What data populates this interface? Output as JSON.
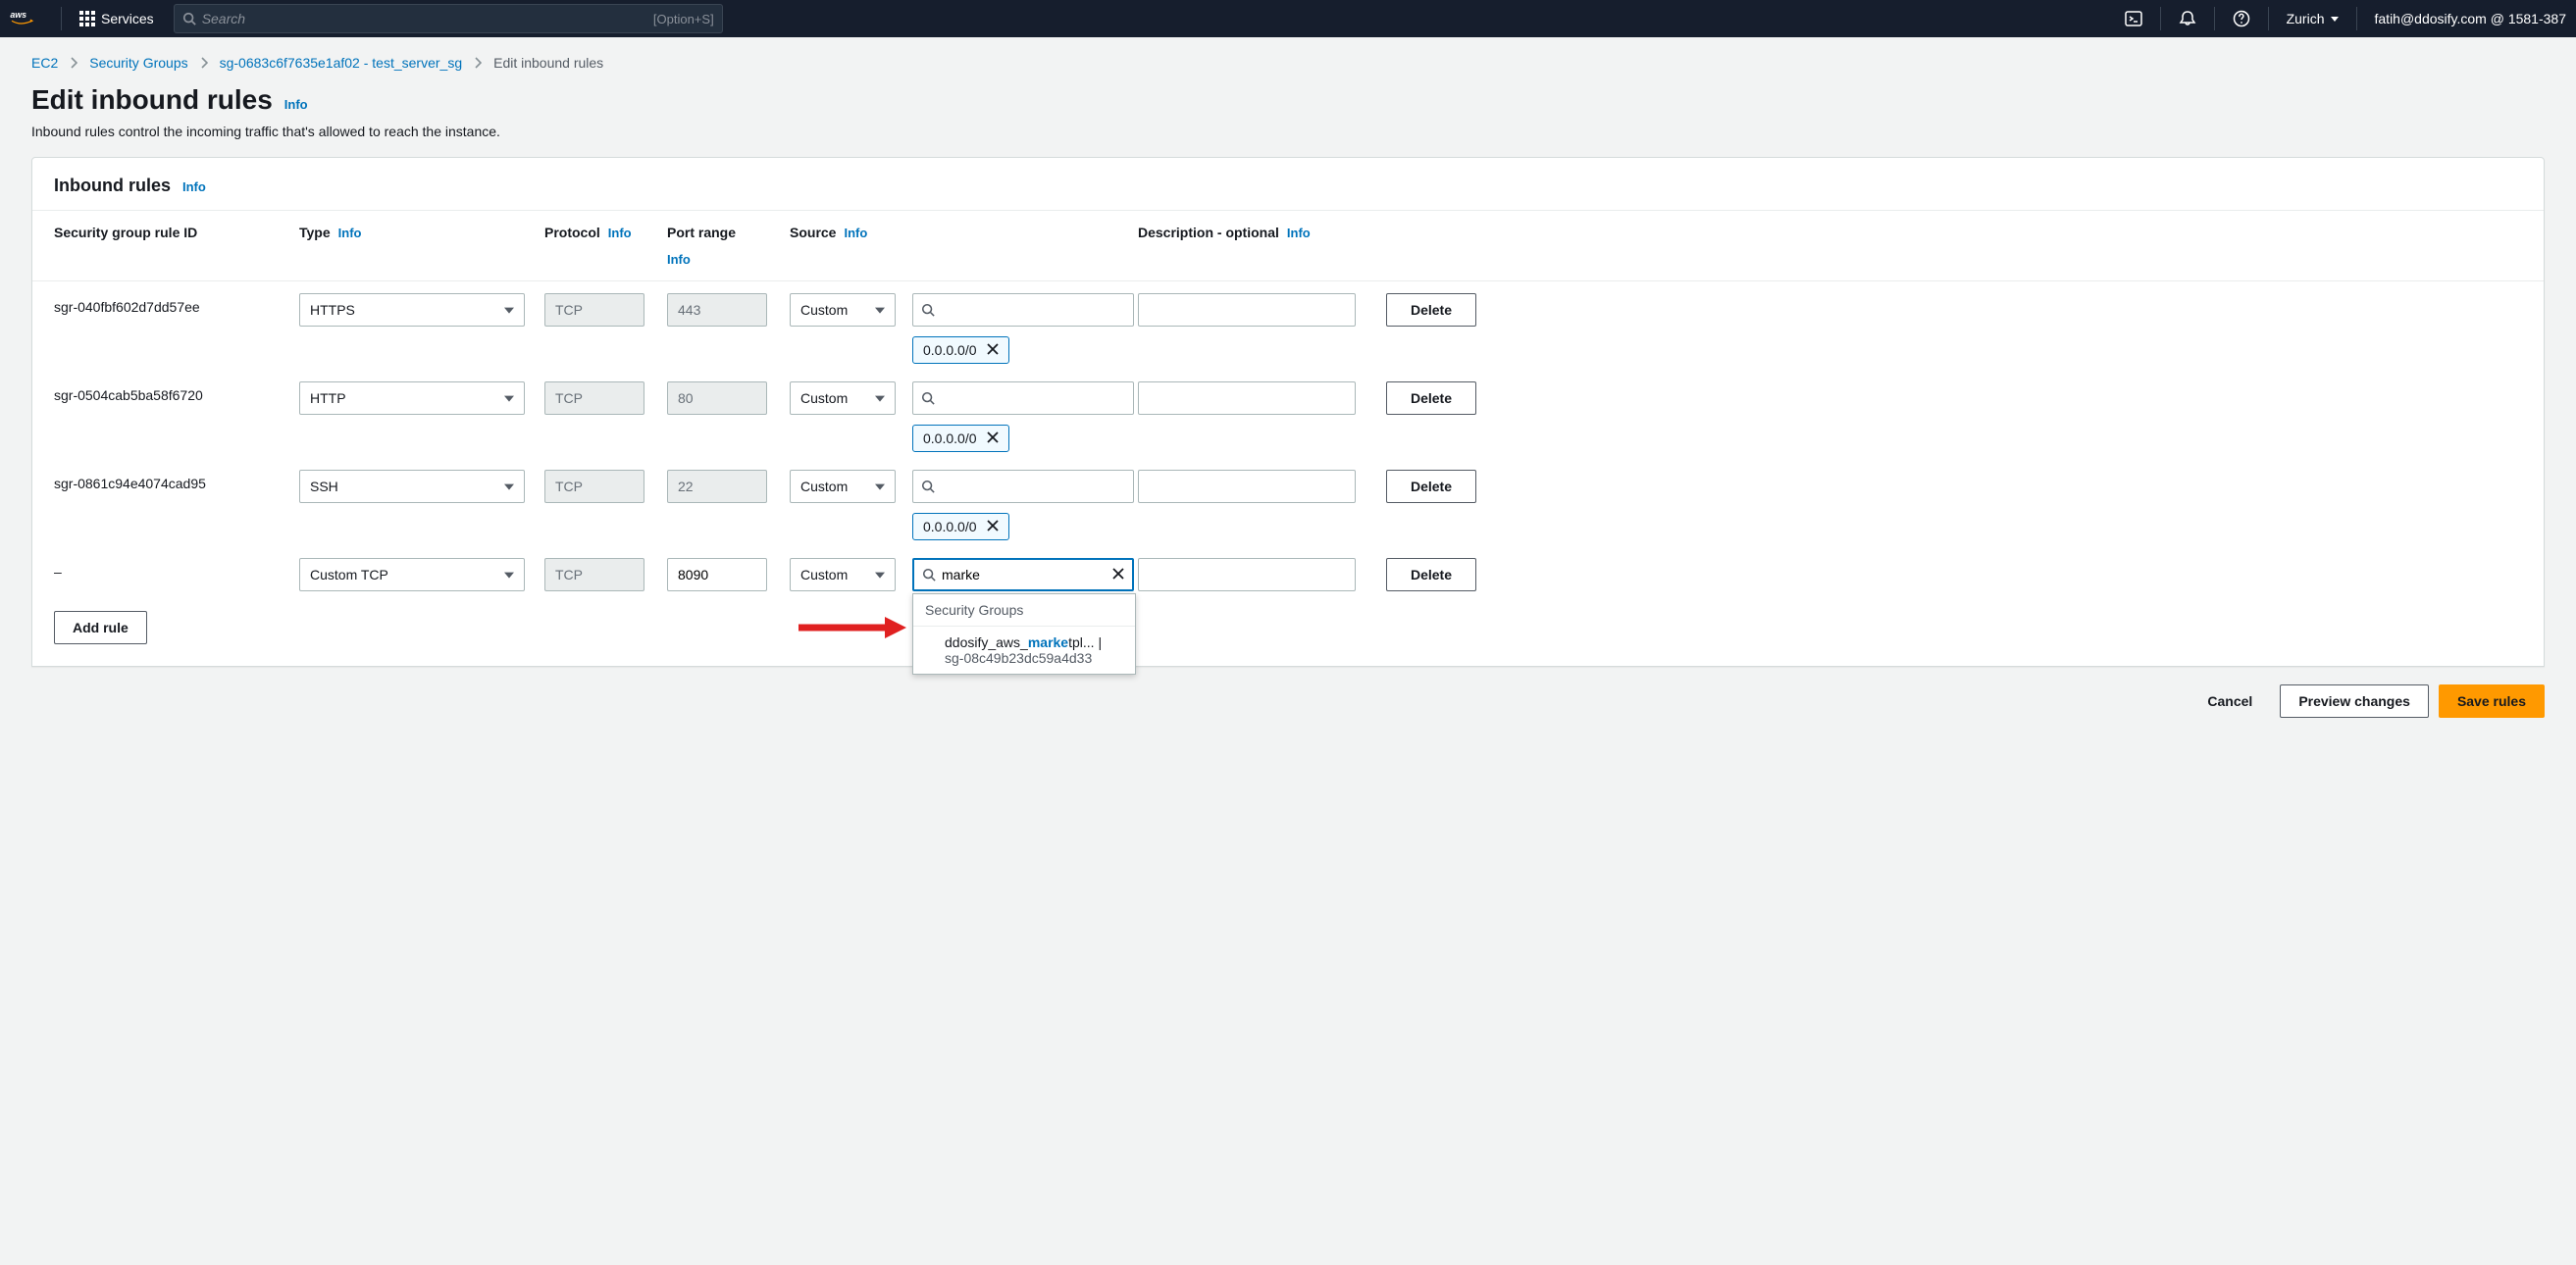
{
  "nav": {
    "services_label": "Services",
    "search_placeholder": "Search",
    "kbd_hint": "[Option+S]",
    "region": "Zurich",
    "user": "fatih@ddosify.com @ 1581-387"
  },
  "breadcrumb": {
    "items": [
      "EC2",
      "Security Groups",
      "sg-0683c6f7635e1af02 - test_server_sg"
    ],
    "current": "Edit inbound rules"
  },
  "page": {
    "title": "Edit inbound rules",
    "info_label": "Info",
    "subtitle": "Inbound rules control the incoming traffic that's allowed to reach the instance."
  },
  "panel": {
    "title": "Inbound rules",
    "columns": {
      "rule_id": "Security group rule ID",
      "type": "Type",
      "protocol": "Protocol",
      "port_range": "Port range",
      "source": "Source",
      "description": "Description - optional"
    },
    "info_label": "Info",
    "delete_label": "Delete",
    "add_rule_label": "Add rule"
  },
  "rules": [
    {
      "id": "sgr-040fbf602d7dd57ee",
      "type": "HTTPS",
      "protocol": "TCP",
      "port": "443",
      "port_editable": false,
      "source_mode": "Custom",
      "source_tag": "0.0.0.0/0",
      "search_value": ""
    },
    {
      "id": "sgr-0504cab5ba58f6720",
      "type": "HTTP",
      "protocol": "TCP",
      "port": "80",
      "port_editable": false,
      "source_mode": "Custom",
      "source_tag": "0.0.0.0/0",
      "search_value": ""
    },
    {
      "id": "sgr-0861c94e4074cad95",
      "type": "SSH",
      "protocol": "TCP",
      "port": "22",
      "port_editable": false,
      "source_mode": "Custom",
      "source_tag": "0.0.0.0/0",
      "search_value": ""
    },
    {
      "id": "–",
      "type": "Custom TCP",
      "protocol": "TCP",
      "port": "8090",
      "port_editable": true,
      "source_mode": "Custom",
      "source_tag": "",
      "search_value": "marke",
      "active": true
    }
  ],
  "dropdown": {
    "header": "Security Groups",
    "item_prefix": "ddosify_aws_",
    "item_match": "marke",
    "item_suffix": "tpl... |",
    "item_sg": "sg-08c49b23dc59a4d33"
  },
  "footer": {
    "cancel": "Cancel",
    "preview": "Preview changes",
    "save": "Save rules"
  }
}
